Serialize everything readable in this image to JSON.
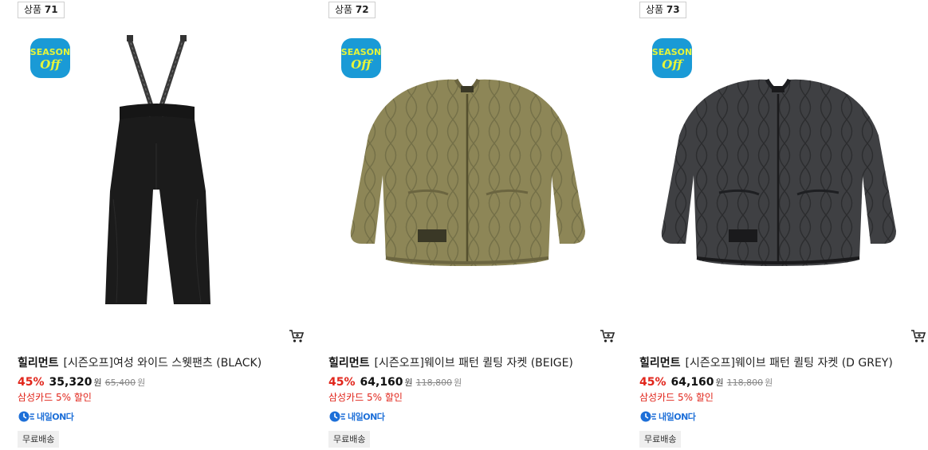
{
  "badge": {
    "line1": "SEASON",
    "line2": "Off",
    "color": "#1a9ad6",
    "text_color": "#e6f53a"
  },
  "labels": {
    "currency": "원"
  },
  "products": [
    {
      "rank_label": "상품",
      "rank": "71",
      "brand": "힐리먼트",
      "name": "[시즌오프]여성 와이드 스웻팬츠 (BLACK)",
      "discount_rate": "45%",
      "sale_price": "35,320",
      "original_price": "65,400",
      "card_discount": "삼성카드 5% 할인",
      "delivery_tag": "내일ON다",
      "shipping": "무료배송",
      "image_icon": "black-suspender-sweatpants",
      "image_color": "#1b1b1b"
    },
    {
      "rank_label": "상품",
      "rank": "72",
      "brand": "힐리먼트",
      "name": "[시즌오프]웨이브 패턴 퀼팅 자켓 (BEIGE)",
      "discount_rate": "45%",
      "sale_price": "64,160",
      "original_price": "118,800",
      "card_discount": "삼성카드 5% 할인",
      "delivery_tag": "내일ON다",
      "shipping": "무료배송",
      "image_icon": "beige-quilted-jacket",
      "image_color": "#8d8657"
    },
    {
      "rank_label": "상품",
      "rank": "73",
      "brand": "힐리먼트",
      "name": "[시즌오프]웨이브 패턴 퀼팅 자켓 (D GREY)",
      "discount_rate": "45%",
      "sale_price": "64,160",
      "original_price": "118,800",
      "card_discount": "삼성카드 5% 할인",
      "delivery_tag": "내일ON다",
      "shipping": "무료배송",
      "image_icon": "dark-grey-quilted-jacket",
      "image_color": "#3f4043"
    }
  ],
  "colors": {
    "discount_red": "#e1251b",
    "delivery_blue": "#1d6fd8"
  }
}
